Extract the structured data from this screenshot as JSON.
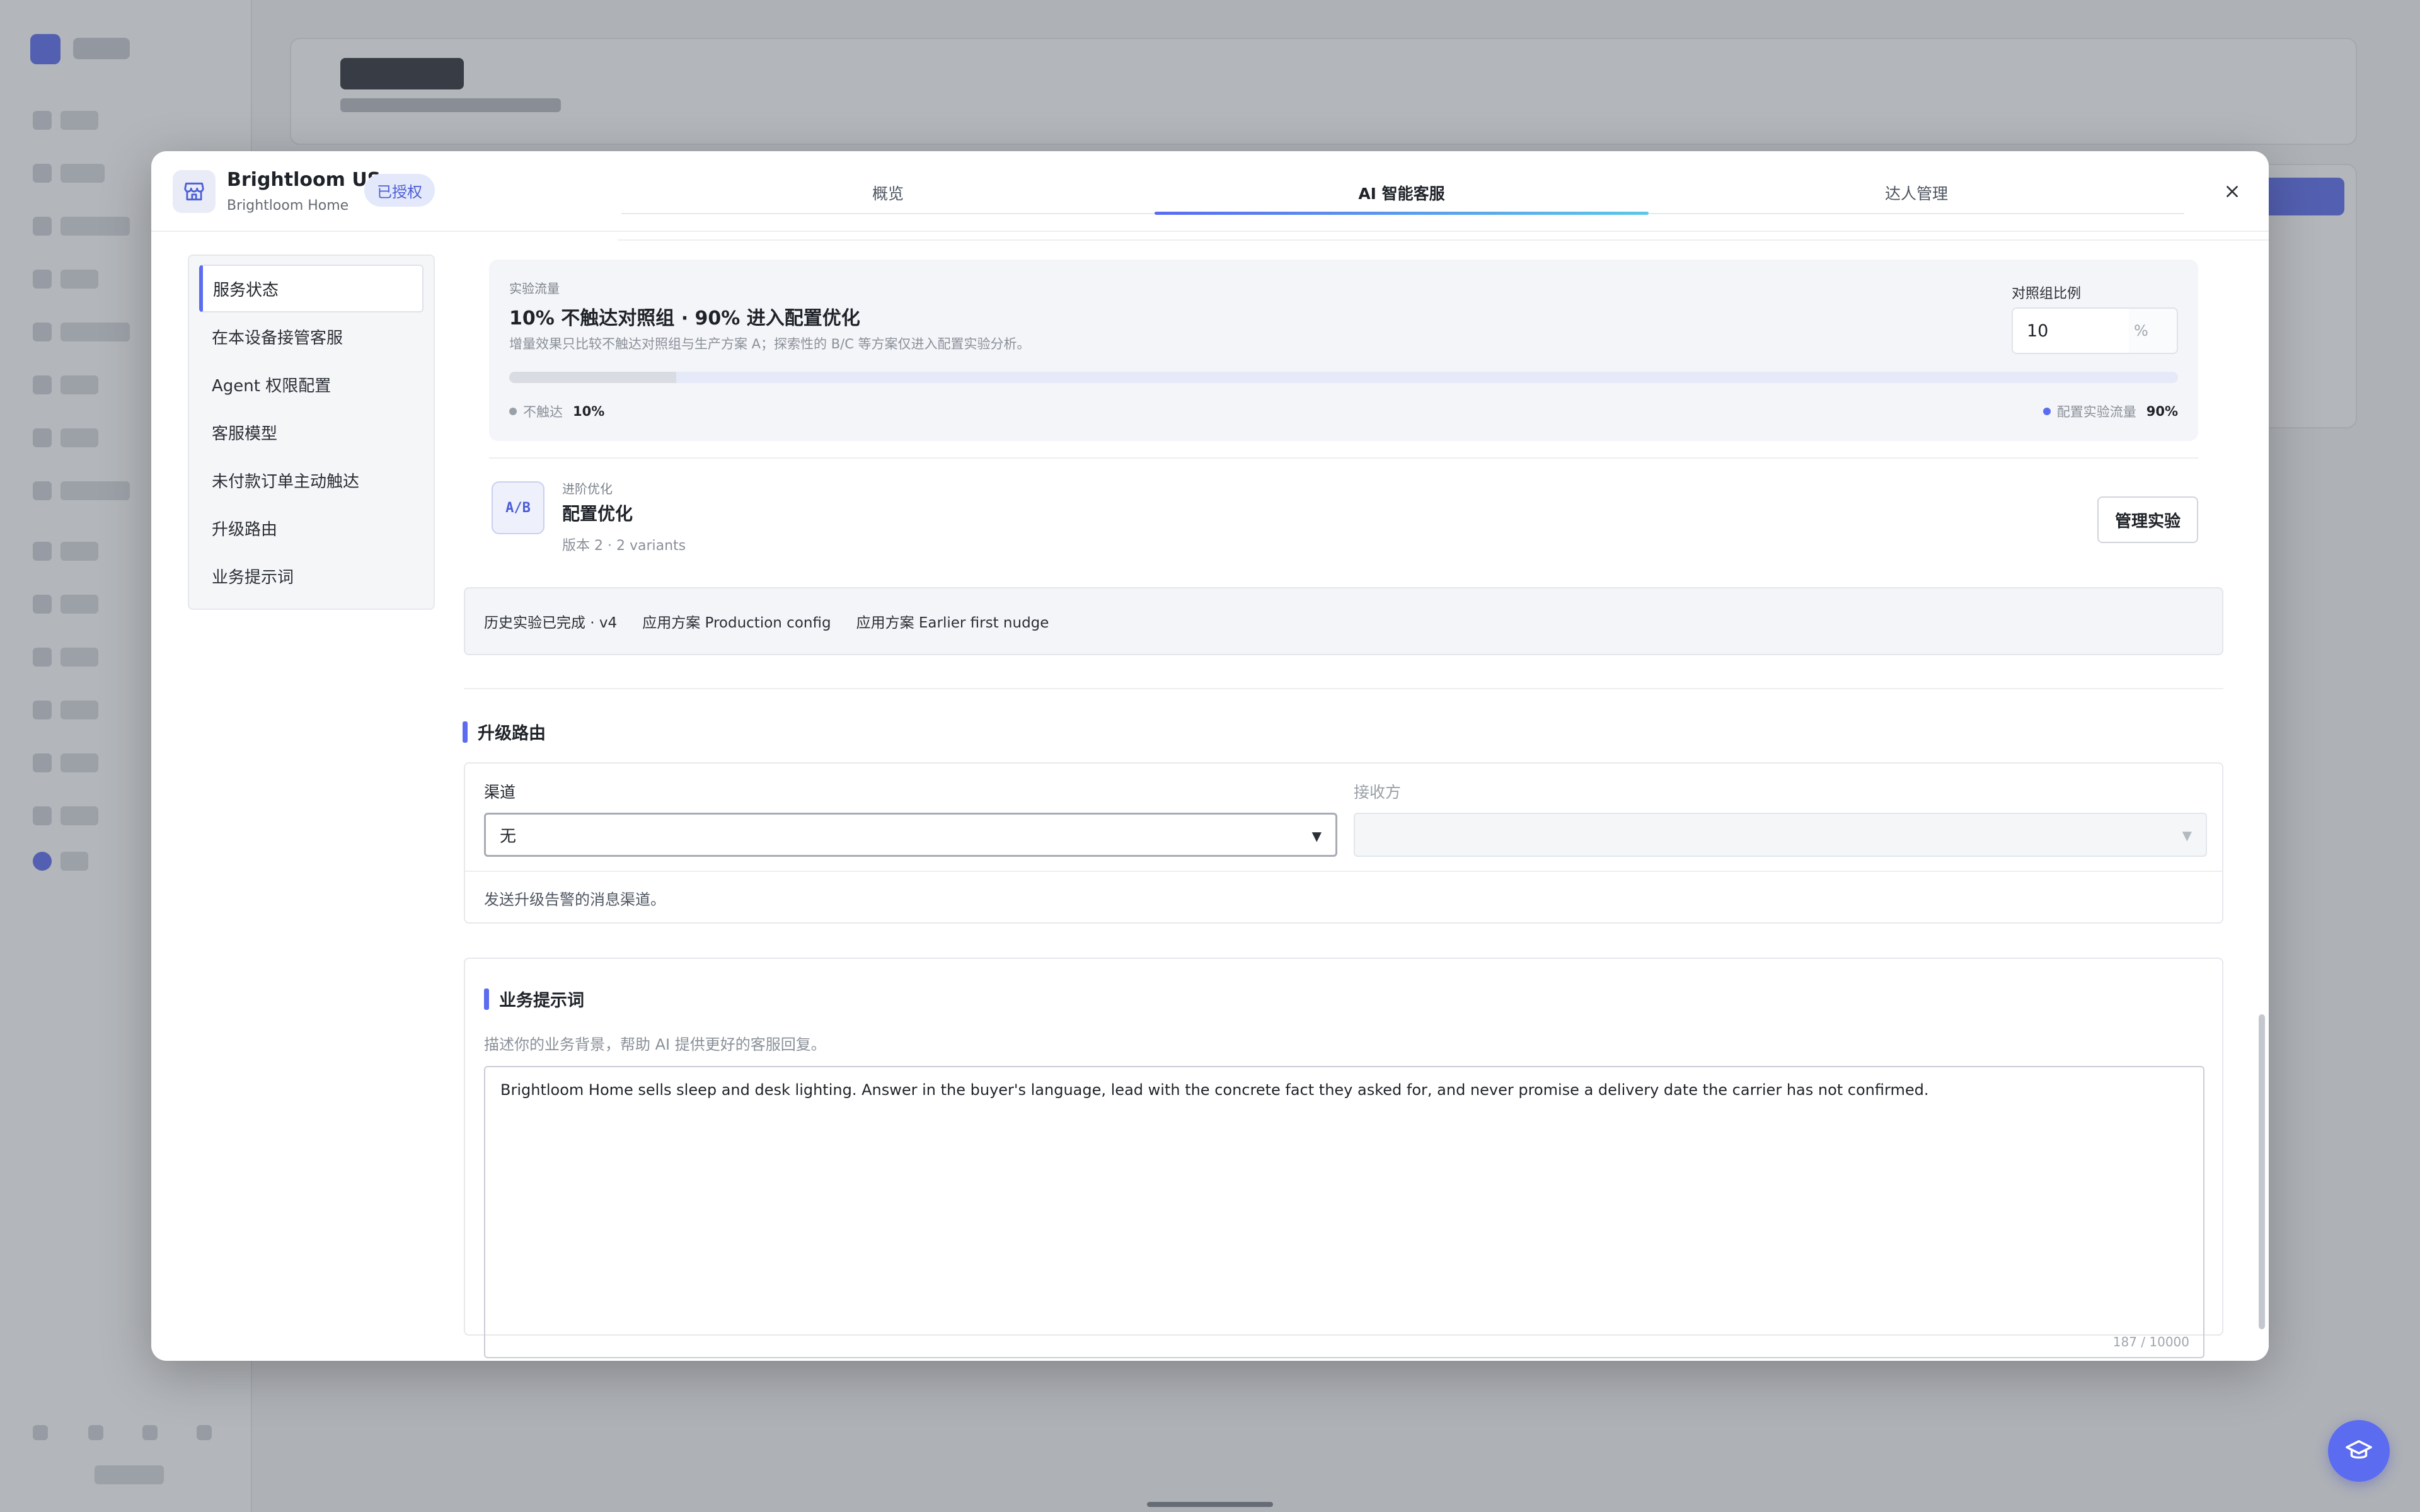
{
  "store": {
    "name": "Brightloom US",
    "subtitle": "Brightloom Home",
    "badge": "已授权"
  },
  "tabs": [
    {
      "label": "概览",
      "active": false
    },
    {
      "label": "AI 智能客服",
      "active": true
    },
    {
      "label": "达人管理",
      "active": false
    }
  ],
  "side_nav": {
    "items": [
      {
        "label": "服务状态",
        "active": true
      },
      {
        "label": "在本设备接管客服",
        "active": false
      },
      {
        "label": "Agent 权限配置",
        "active": false
      },
      {
        "label": "客服模型",
        "active": false
      },
      {
        "label": "未付款订单主动触达",
        "active": false
      },
      {
        "label": "升级路由",
        "active": false
      },
      {
        "label": "业务提示词",
        "active": false
      }
    ]
  },
  "experiment": {
    "eyebrow": "实验流量",
    "title": "10% 不触达对照组 · 90% 进入配置优化",
    "description": "增量效果只比较不触达对照组与生产方案 A；探索性的 B/C 等方案仅进入配置实验分析。",
    "control_ratio_label": "对照组比例",
    "control_ratio_value": "10",
    "control_ratio_unit": "%",
    "control_fraction": 0.1,
    "legend_left_label": "不触达",
    "legend_left_value": "10%",
    "legend_right_label": "配置实验流量",
    "legend_right_value": "90%"
  },
  "ab_test": {
    "icon_text": "A/B",
    "eyebrow": "进阶优化",
    "title": "配置优化",
    "meta": "版本 2 · 2 variants",
    "manage_button": "管理实验"
  },
  "history": {
    "status": "历史实验已完成 · v4",
    "plan_1": "应用方案 Production config",
    "plan_2": "应用方案 Earlier first nudge"
  },
  "escalation": {
    "section_title": "升级路由",
    "channel_label": "渠道",
    "channel_value": "无",
    "recipient_label": "接收方",
    "recipient_value": "",
    "help": "发送升级告警的消息渠道。"
  },
  "business_prompt": {
    "section_title": "业务提示词",
    "help": "描述你的业务背景，帮助 AI 提供更好的客服回复。",
    "value": "Brightloom Home sells sleep and desk lighting. Answer in the buyer's language, lead with the concrete fact they asked for, and never promise a delivery date the carrier has not confirmed.",
    "char_count": "187 / 10000"
  },
  "colors": {
    "accent": "#5b6cf0",
    "accent_gradient_end": "#5bc8e8",
    "badge_bg": "#e3e8fb",
    "badge_text": "#4c5fd5"
  },
  "icons": {
    "store": "store-icon",
    "close": "close-icon",
    "help_fab": "graduation-cap-icon",
    "caret": "chevron-down-icon"
  }
}
